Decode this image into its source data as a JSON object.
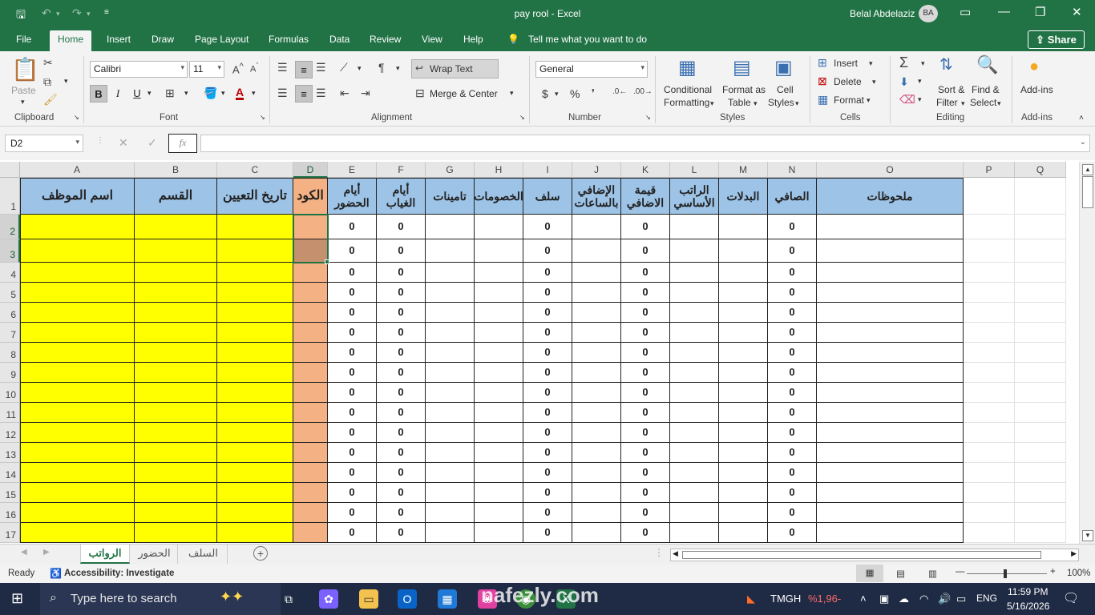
{
  "window": {
    "title": "pay rool  -  Excel",
    "user": "Belal Abdelaziz",
    "avatar_initials": "BA"
  },
  "tabs": [
    {
      "label": "File"
    },
    {
      "label": "Home"
    },
    {
      "label": "Insert"
    },
    {
      "label": "Draw"
    },
    {
      "label": "Page Layout"
    },
    {
      "label": "Formulas"
    },
    {
      "label": "Data"
    },
    {
      "label": "Review"
    },
    {
      "label": "View"
    },
    {
      "label": "Help"
    }
  ],
  "tell_me": "Tell me what you want to do",
  "share": "Share",
  "ribbon": {
    "clipboard": {
      "paste": "Paste",
      "label": "Clipboard"
    },
    "font": {
      "name": "Calibri",
      "size": "11",
      "label": "Font",
      "bold": "B",
      "italic": "I",
      "underline": "U"
    },
    "alignment": {
      "wrap_text": "Wrap Text",
      "merge_center": "Merge & Center",
      "label": "Alignment"
    },
    "number": {
      "format": "General",
      "label": "Number",
      "currency": "$",
      "percent": "%",
      "comma": "❜"
    },
    "styles": {
      "conditional": "Conditional",
      "conditional2": "Formatting",
      "format_table": "Format as",
      "format_table2": "Table",
      "cell_styles": "Cell",
      "cell_styles2": "Styles",
      "label": "Styles"
    },
    "cells": {
      "insert": "Insert",
      "delete": "Delete",
      "format": "Format",
      "label": "Cells"
    },
    "editing": {
      "sort": "Sort &",
      "sort2": "Filter",
      "find": "Find &",
      "find2": "Select",
      "label": "Editing"
    },
    "addins": {
      "name": "Add-ins",
      "label": "Add-ins"
    }
  },
  "formula_bar": {
    "name_box": "D2",
    "fx": "fx",
    "value": ""
  },
  "columns": [
    "A",
    "B",
    "C",
    "D",
    "E",
    "F",
    "G",
    "H",
    "I",
    "J",
    "K",
    "L",
    "M",
    "N",
    "O",
    "P",
    "Q"
  ],
  "rows": [
    "1",
    "2",
    "3",
    "4",
    "5",
    "6",
    "7",
    "8",
    "9",
    "10",
    "11",
    "12",
    "13",
    "14",
    "15",
    "16",
    "17"
  ],
  "sheet": {
    "headers": {
      "A": "اسم الموظف",
      "B": "القسم",
      "C": "تاريخ التعيين",
      "D": "الكود",
      "E": "أيام الحضور",
      "F": "أيام الغياب",
      "G": "تامينات",
      "H": "الخصومات",
      "I": "سلف",
      "J": "الإضافي بالساعات",
      "K": "قيمة الاضافي",
      "L": "الراتب الأساسي",
      "M": "البدلات",
      "N": "الصافي",
      "O": "ملحوظات"
    },
    "zero_value": "0",
    "zero_columns": [
      "E",
      "F",
      "I",
      "K",
      "N"
    ]
  },
  "sheet_tabs": [
    "الرواتب",
    "الحضور",
    "السلف"
  ],
  "status": {
    "ready": "Ready",
    "accessibility": "Accessibility: Investigate",
    "zoom": "100%"
  },
  "taskbar": {
    "search": "Type here to search",
    "weather_name": "TMGH",
    "weather_value": "%1,96-",
    "lang": "ENG",
    "time": "11:59 PM",
    "date": "5/16/2026"
  },
  "watermark": "nafezly.com",
  "colors": {
    "excel_green": "#217346",
    "header_blue": "#9dc3e6",
    "yellow": "#ffff00",
    "salmon": "#f4b183"
  }
}
